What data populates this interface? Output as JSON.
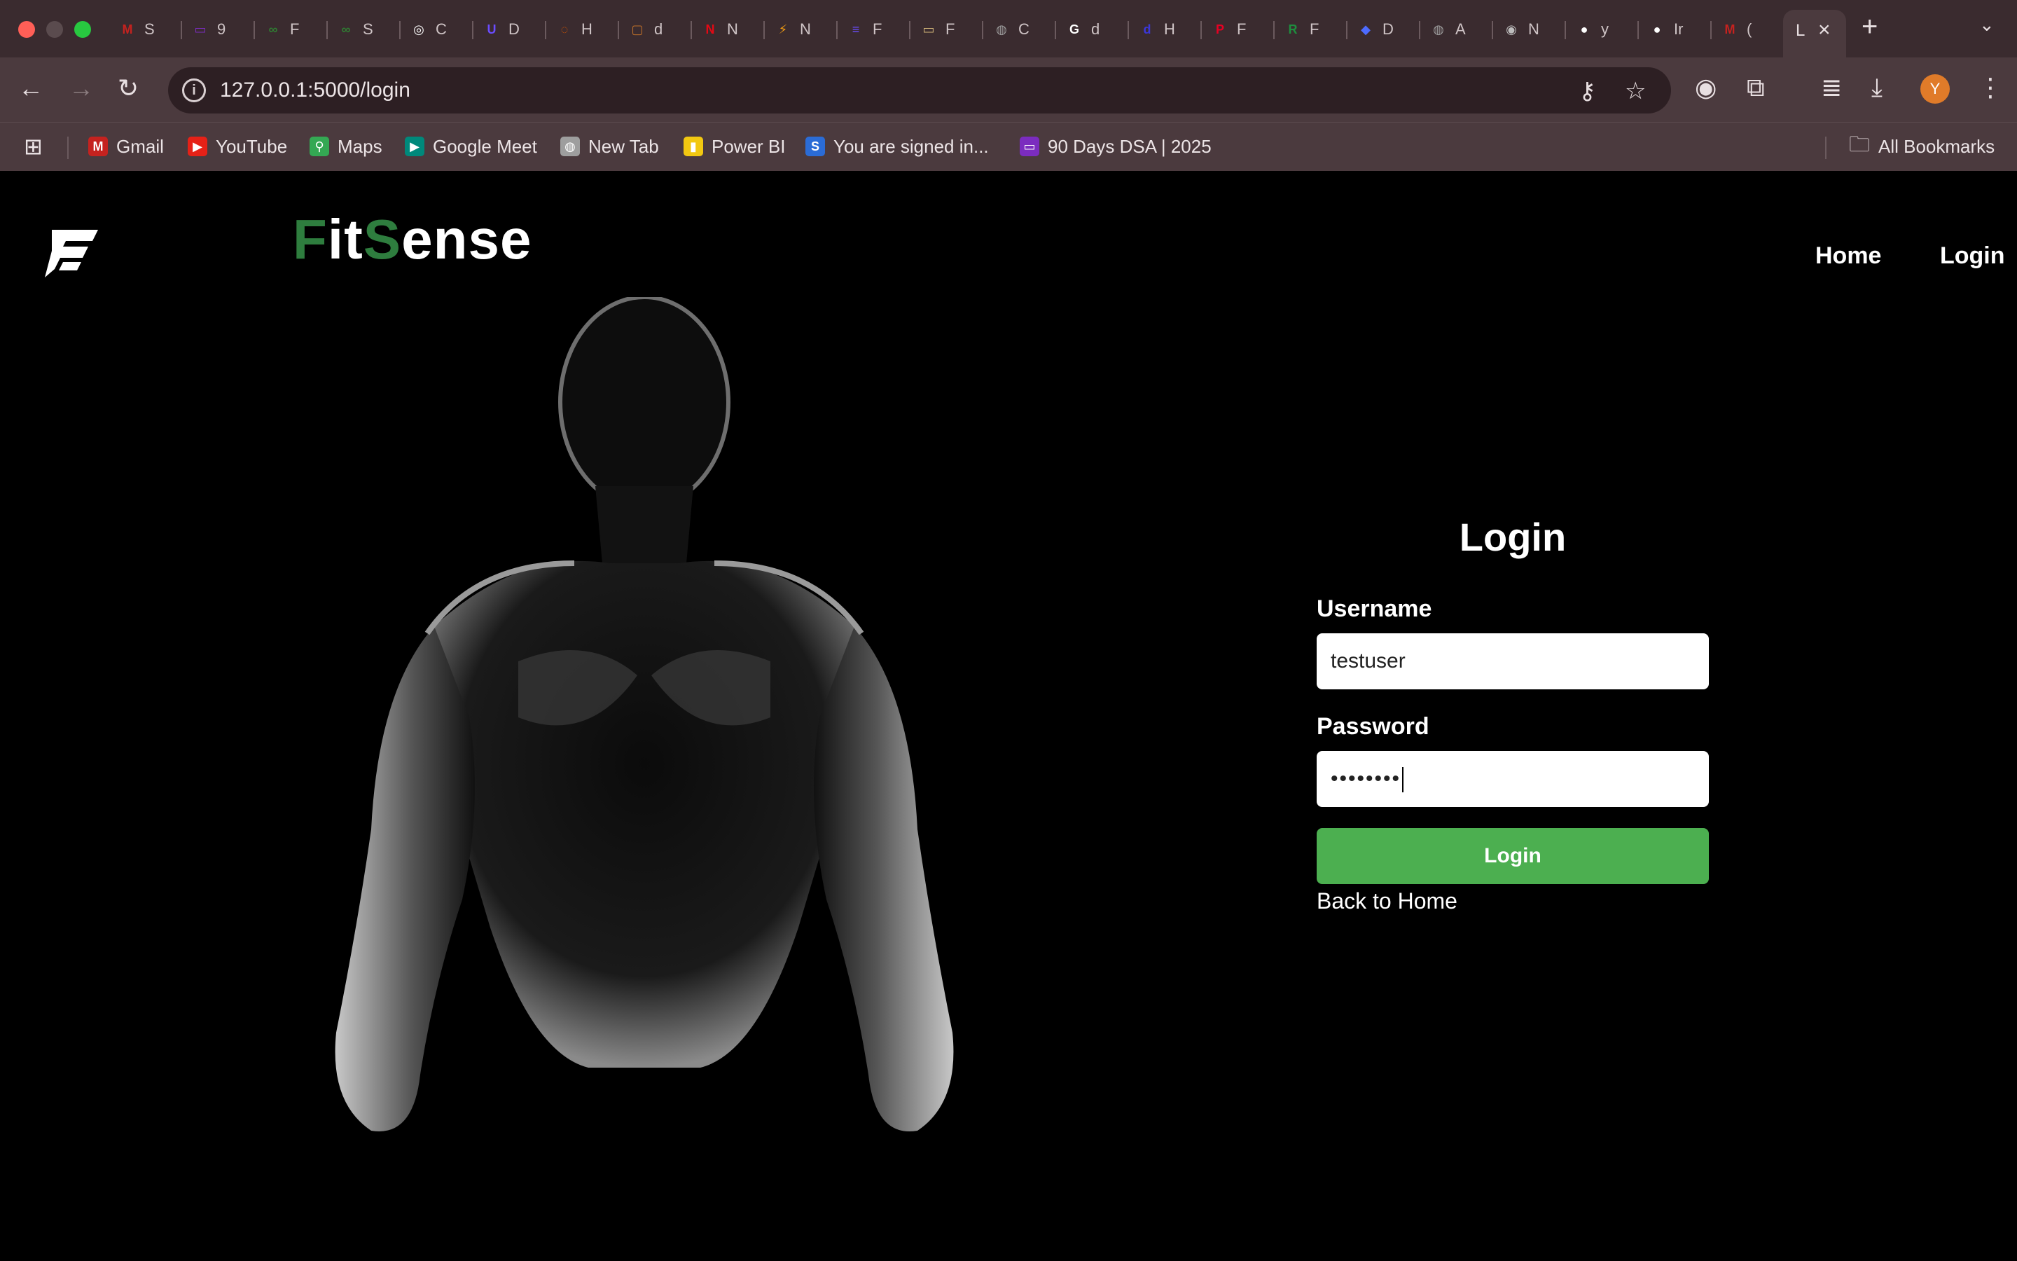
{
  "browser": {
    "tabs": [
      {
        "title": "S",
        "icon": "gmail-icon",
        "color": "#c5221f",
        "glyph": "M"
      },
      {
        "title": "9",
        "icon": "monitor-icon",
        "color": "#7b2cbf",
        "glyph": "▭"
      },
      {
        "title": "F",
        "icon": "infinity-icon",
        "color": "#2f7d32",
        "glyph": "∞"
      },
      {
        "title": "S",
        "icon": "infinity-icon",
        "color": "#2f7d32",
        "glyph": "∞"
      },
      {
        "title": "C",
        "icon": "openai-icon",
        "color": "#ffffff",
        "glyph": "◎"
      },
      {
        "title": "D",
        "icon": "shield-icon",
        "color": "#6a4cff",
        "glyph": "U"
      },
      {
        "title": "H",
        "icon": "circle-icon",
        "color": "#d35400",
        "glyph": "◌"
      },
      {
        "title": "d",
        "icon": "document-icon",
        "color": "#c0702a",
        "glyph": "▢"
      },
      {
        "title": "N",
        "icon": "netflix-icon",
        "color": "#e50914",
        "glyph": "N"
      },
      {
        "title": "N",
        "icon": "bolt-icon",
        "color": "#f39c12",
        "glyph": "⚡"
      },
      {
        "title": "F",
        "icon": "list-icon",
        "color": "#6a4cff",
        "glyph": "≡"
      },
      {
        "title": "F",
        "icon": "card-icon",
        "color": "#d4b77a",
        "glyph": "▭"
      },
      {
        "title": "C",
        "icon": "globe-icon",
        "color": "#9e9e9e",
        "glyph": "◍"
      },
      {
        "title": "d",
        "icon": "google-icon",
        "color": "#ffffff",
        "glyph": "G"
      },
      {
        "title": "H",
        "icon": "app-icon",
        "color": "#3b37d9",
        "glyph": "d"
      },
      {
        "title": "F",
        "icon": "pinterest-icon",
        "color": "#e60023",
        "glyph": "P"
      },
      {
        "title": "F",
        "icon": "r-icon",
        "color": "#1e8e3e",
        "glyph": "R"
      },
      {
        "title": "D",
        "icon": "whale-icon",
        "color": "#4d6bfe",
        "glyph": "◆"
      },
      {
        "title": "A",
        "icon": "globe-icon",
        "color": "#9e9e9e",
        "glyph": "◍"
      },
      {
        "title": "N",
        "icon": "chrome-icon",
        "color": "#bdbdbd",
        "glyph": "◉"
      },
      {
        "title": "y",
        "icon": "github-icon",
        "color": "#ffffff",
        "glyph": "●"
      },
      {
        "title": "Ir",
        "icon": "github-icon",
        "color": "#ffffff",
        "glyph": "●"
      },
      {
        "title": "(",
        "icon": "gmail-icon",
        "color": "#c5221f",
        "glyph": "M"
      }
    ],
    "active_tab_title": "L",
    "url": "127.0.0.1:5000/login",
    "profile_initial": "Y",
    "bookmarks": [
      {
        "label": "Gmail",
        "icon": "gmail-icon",
        "color": "#c5221f",
        "glyph": "M"
      },
      {
        "label": "YouTube",
        "icon": "youtube-icon",
        "color": "#e62117",
        "glyph": "▶"
      },
      {
        "label": "Maps",
        "icon": "maps-icon",
        "color": "#34a853",
        "glyph": "⚲"
      },
      {
        "label": "Google Meet",
        "icon": "meet-icon",
        "color": "#00897b",
        "glyph": "▶"
      },
      {
        "label": "New Tab",
        "icon": "globe-icon",
        "color": "#9e9e9e",
        "glyph": "◍"
      },
      {
        "label": "Power BI",
        "icon": "powerbi-icon",
        "color": "#f2c811",
        "glyph": "▮"
      },
      {
        "label": "You are signed in...",
        "icon": "s-icon",
        "color": "#2b6cd6",
        "glyph": "S"
      },
      {
        "label": "90 Days DSA | 2025",
        "icon": "monitor-icon",
        "color": "#7b2cbf",
        "glyph": "▭"
      }
    ],
    "all_bookmarks_label": "All Bookmarks"
  },
  "site": {
    "brand": {
      "p1": "F",
      "p2": "it",
      "p3": "S",
      "p4": "ense"
    },
    "nav": {
      "home": "Home",
      "login": "Login"
    },
    "form": {
      "title": "Login",
      "username_label": "Username",
      "username_value": "testuser",
      "password_label": "Password",
      "password_masked": "••••••••",
      "submit_label": "Login",
      "back_link": "Back to Home"
    },
    "colors": {
      "accent_green": "#4caf50",
      "brand_green": "#2e7d3e",
      "background": "#000000"
    }
  }
}
